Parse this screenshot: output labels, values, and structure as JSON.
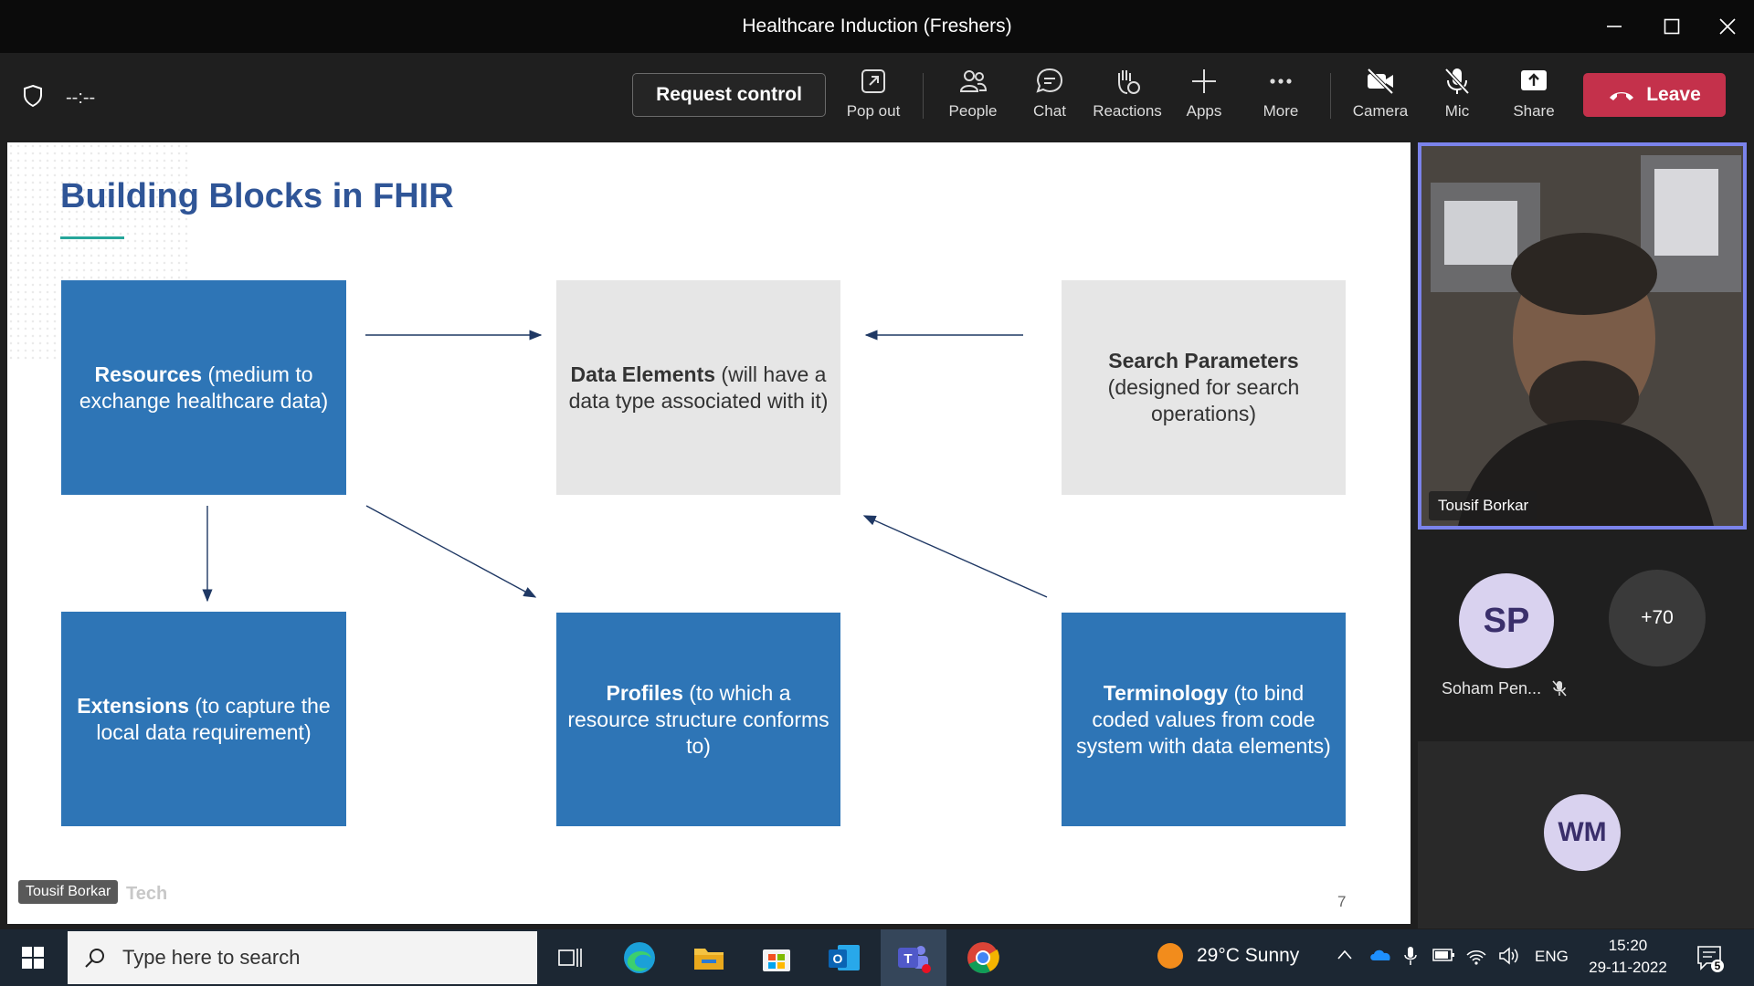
{
  "window": {
    "title": "Healthcare Induction (Freshers)"
  },
  "toolbar": {
    "timer": "--:--",
    "request_control": "Request control",
    "buttons": [
      {
        "label": "Pop out",
        "icon": "pop-out-icon"
      },
      {
        "label": "People",
        "icon": "people-icon"
      },
      {
        "label": "Chat",
        "icon": "chat-icon"
      },
      {
        "label": "Reactions",
        "icon": "reactions-icon"
      },
      {
        "label": "Apps",
        "icon": "plus-icon"
      },
      {
        "label": "More",
        "icon": "more-icon"
      },
      {
        "label": "Camera",
        "icon": "camera-off-icon"
      },
      {
        "label": "Mic",
        "icon": "mic-off-icon"
      },
      {
        "label": "Share",
        "icon": "share-icon"
      }
    ],
    "leave": "Leave"
  },
  "slide": {
    "title": "Building Blocks in FHIR",
    "boxes": {
      "resources": {
        "bold": "Resources",
        "rest": " (medium to exchange healthcare data)"
      },
      "data_elements": {
        "bold": "Data Elements",
        "rest": " (will have a data type associated with it)"
      },
      "search_parameters": {
        "bold": "Search Parameters",
        "rest": " (designed for search operations)"
      },
      "extensions": {
        "bold": "Extensions",
        "rest": " (to capture the local data requirement)"
      },
      "profiles": {
        "bold": "Profiles",
        "rest": " (to which a resource structure conforms to)"
      },
      "terminology": {
        "bold": "Terminology",
        "rest": " (to bind coded values from code system with data elements)"
      }
    },
    "page_number": "7",
    "brand_text": "Tech",
    "presenter_tag": "Tousif Borkar"
  },
  "participants": {
    "video_name": "Tousif Borkar",
    "sp": {
      "initials": "SP",
      "name": "Soham Pen..."
    },
    "more_count": "+70",
    "wm": {
      "initials": "WM"
    }
  },
  "taskbar": {
    "search_placeholder": "Type here to search",
    "weather": "29°C  Sunny",
    "lang": "ENG",
    "time": "15:20",
    "date": "29-11-2022",
    "notification_count": "5"
  },
  "colors": {
    "accent_blue": "#2e75b6",
    "title_blue": "#2f5597",
    "leave_red": "#c4314b",
    "speaker_border": "#7b83eb"
  }
}
